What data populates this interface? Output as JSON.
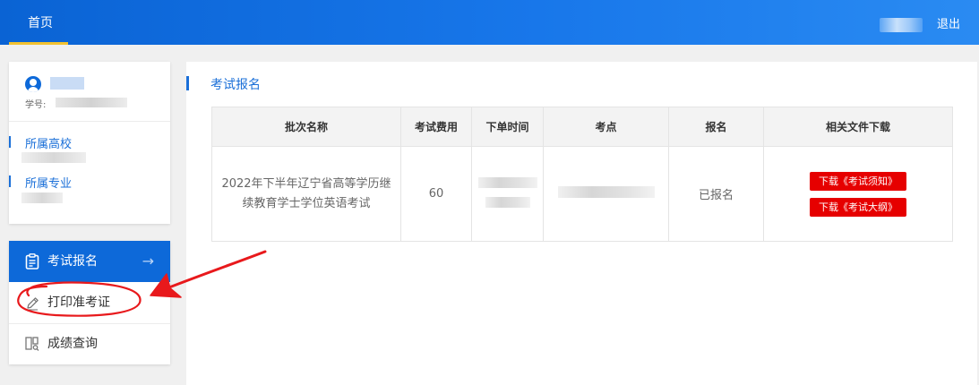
{
  "header": {
    "nav_home": "首页",
    "logout": "退出"
  },
  "profile": {
    "student_no_label": "学号:",
    "school_label": "所属高校",
    "major_label": "所属专业"
  },
  "menu": {
    "items": [
      {
        "label": "考试报名",
        "icon": "clipboard-icon",
        "active": true,
        "arrow": "→"
      },
      {
        "label": "打印准考证",
        "icon": "pencil-icon",
        "active": false
      },
      {
        "label": "成绩查询",
        "icon": "search-doc-icon",
        "active": false
      }
    ]
  },
  "main": {
    "title": "考试报名",
    "table": {
      "headers": [
        "批次名称",
        "考试费用",
        "下单时间",
        "考点",
        "报名",
        "相关文件下载"
      ],
      "rows": [
        {
          "batch_name": "2022年下半年辽宁省高等学历继续教育学士学位英语考试",
          "fee": "60",
          "status": "已报名",
          "downloads": [
            "下载《考试须知》",
            "下载《考试大纲》"
          ]
        }
      ]
    }
  },
  "colors": {
    "header_blue": "#1877ea",
    "accent_blue": "#0d69d9",
    "download_red": "#e60000",
    "annotation_red": "#e8191c"
  }
}
